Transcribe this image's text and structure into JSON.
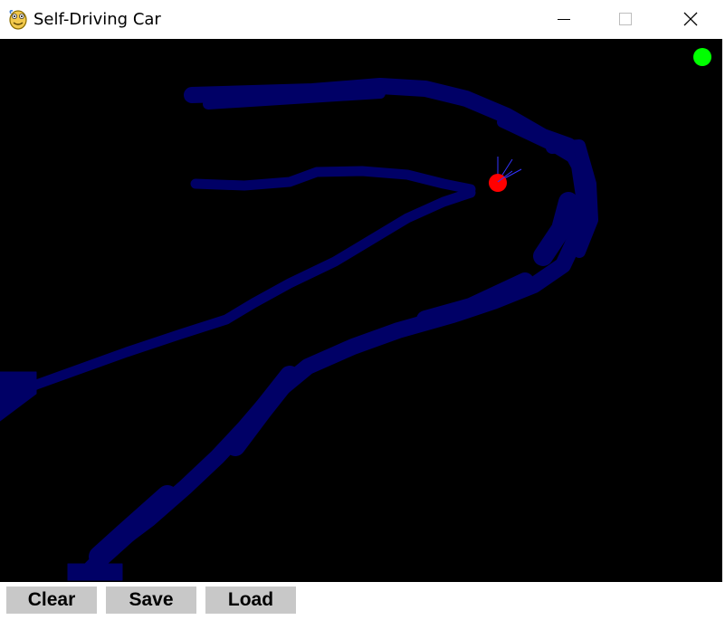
{
  "window": {
    "title": "Self-Driving Car",
    "app_icon": "python-snake-icon",
    "controls": [
      "minimize-icon",
      "maximize-icon",
      "close-icon"
    ]
  },
  "canvas": {
    "background": "#000000",
    "road_color": "#000066",
    "car_color": "#ff0000",
    "sensor_color": "#3333ff",
    "goal_color": "#00ff00"
  },
  "toolbar": {
    "clear_label": "Clear",
    "save_label": "Save",
    "load_label": "Load",
    "button_color": "#c8c8c8"
  }
}
